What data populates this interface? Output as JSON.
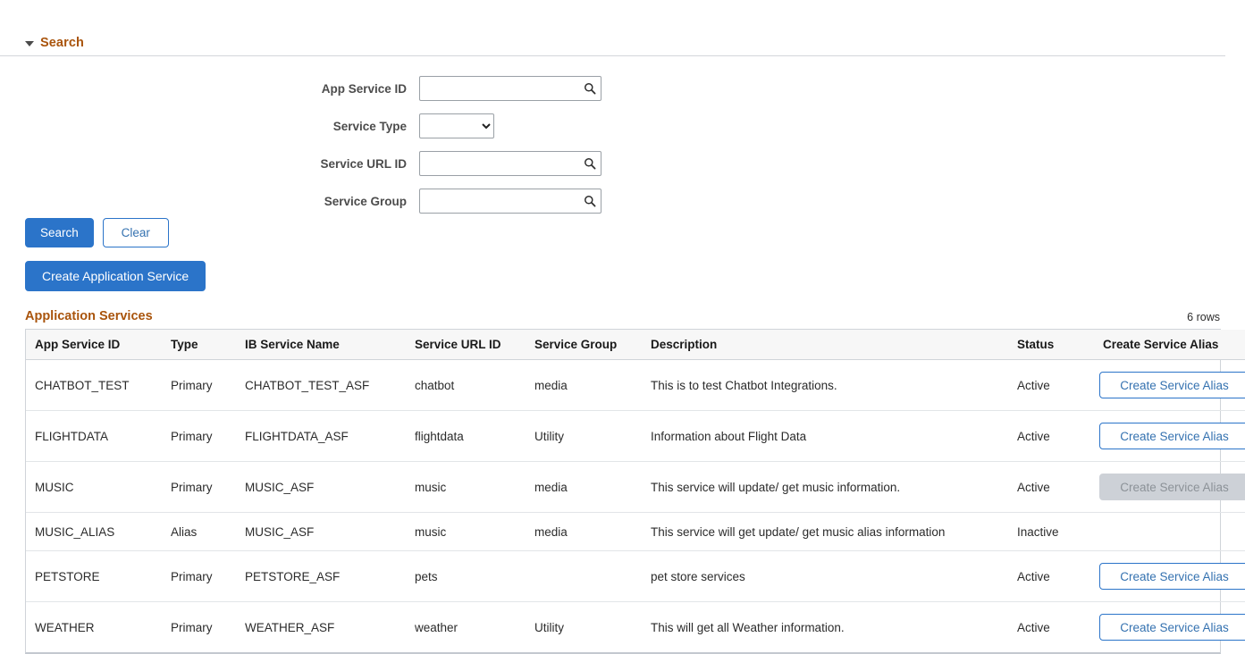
{
  "search_section": {
    "title": "Search",
    "collapse_icon": "caret-down-icon",
    "fields": [
      {
        "label": "App Service ID",
        "type": "text",
        "value": "",
        "placeholder": "",
        "icon": "search-icon"
      },
      {
        "label": "Service Type",
        "type": "select",
        "value": "",
        "options": [
          ""
        ]
      },
      {
        "label": "Service URL ID",
        "type": "text",
        "value": "",
        "placeholder": "",
        "icon": "search-icon"
      },
      {
        "label": "Service Group",
        "type": "text",
        "value": "",
        "placeholder": "",
        "icon": "search-icon"
      }
    ],
    "buttons": {
      "search_label": "Search",
      "clear_label": "Clear",
      "create_label": "Create Application Service"
    }
  },
  "grid": {
    "title": "Application Services",
    "row_count_label": "6 rows",
    "columns": [
      "App Service ID",
      "Type",
      "IB Service Name",
      "Service URL ID",
      "Service Group",
      "Description",
      "Status",
      "Create Service Alias"
    ],
    "rows": [
      {
        "app_service_id": "CHATBOT_TEST",
        "type": "Primary",
        "ib_service_name": "CHATBOT_TEST_ASF",
        "service_url_id": "chatbot",
        "service_group": "media",
        "description": "This is to test Chatbot Integrations.",
        "status": "Active",
        "alias_button": {
          "label": "Create Service Alias",
          "state": "enabled"
        },
        "chevron": "chevron-right-icon"
      },
      {
        "app_service_id": "FLIGHTDATA",
        "type": "Primary",
        "ib_service_name": "FLIGHTDATA_ASF",
        "service_url_id": "flightdata",
        "service_group": "Utility",
        "description": "Information about Flight Data",
        "status": "Active",
        "alias_button": {
          "label": "Create Service Alias",
          "state": "enabled"
        },
        "chevron": "chevron-right-icon"
      },
      {
        "app_service_id": "MUSIC",
        "type": "Primary",
        "ib_service_name": "MUSIC_ASF",
        "service_url_id": "music",
        "service_group": "media",
        "description": "This service will update/ get music information.",
        "status": "Active",
        "alias_button": {
          "label": "Create Service Alias",
          "state": "disabled"
        },
        "chevron": "chevron-right-icon"
      },
      {
        "app_service_id": "MUSIC_ALIAS",
        "type": "Alias",
        "ib_service_name": "MUSIC_ASF",
        "service_url_id": "music",
        "service_group": "media",
        "description": "This service will get update/ get music alias information",
        "status": "Inactive",
        "alias_button": {
          "label": "",
          "state": "hidden"
        },
        "chevron": "chevron-right-icon"
      },
      {
        "app_service_id": "PETSTORE",
        "type": "Primary",
        "ib_service_name": "PETSTORE_ASF",
        "service_url_id": "pets",
        "service_group": "",
        "description": "pet store services",
        "status": "Active",
        "alias_button": {
          "label": "Create Service Alias",
          "state": "enabled"
        },
        "chevron": "chevron-right-icon"
      },
      {
        "app_service_id": "WEATHER",
        "type": "Primary",
        "ib_service_name": "WEATHER_ASF",
        "service_url_id": "weather",
        "service_group": "Utility",
        "description": "This will get all Weather information.",
        "status": "Active",
        "alias_button": {
          "label": "Create Service Alias",
          "state": "enabled"
        },
        "chevron": "chevron-right-icon"
      }
    ]
  },
  "colors": {
    "heading_brown": "#a9540c",
    "primary_blue": "#2b74c9",
    "link_blue": "#3572b0",
    "header_bg": "#f7f7f7",
    "disabled_grey": "#cdd1d7"
  }
}
